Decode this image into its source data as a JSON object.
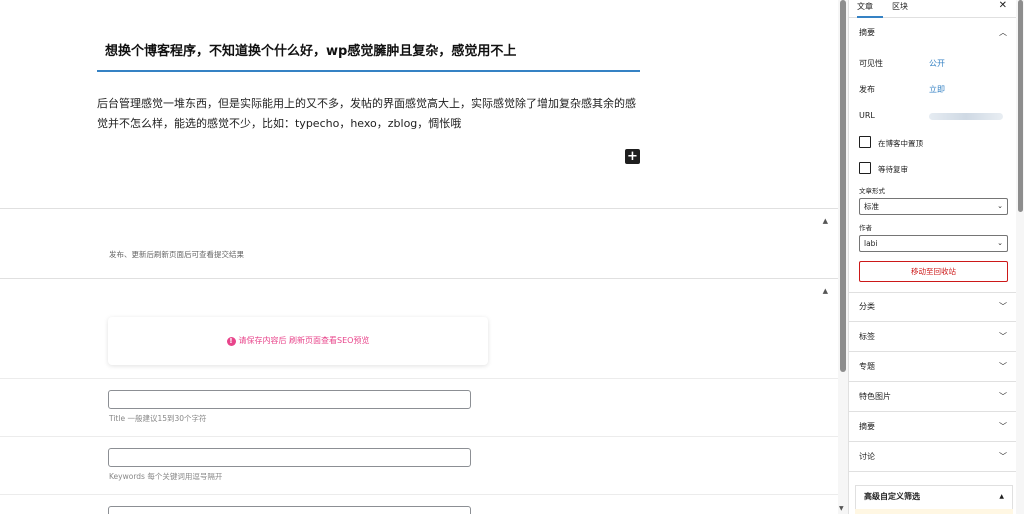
{
  "post": {
    "title": "想换个博客程序，不知道换个什么好，wp感觉臃肿且复杂，感觉用不上",
    "body": "后台管理感觉一堆东西，但是实际能用上的又不多，发帖的界面感觉高大上，实际感觉除了增加复杂感其余的感觉并不怎么样，能选的感觉不少，比如：typecho，hexo，zblog，惆怅哦",
    "add_block_symbol": "+"
  },
  "meta_boxes": {
    "publish_hint": "发布、更新后刷新页面后可查看提交结果",
    "collapse_symbol": "▲",
    "seo_notice": "请保存内容后 刷新页面查看SEO预览",
    "seo_title_hint": "Title 一般建议15到30个字符",
    "seo_keywords_hint": "Keywords 每个关键词用逗号隔开"
  },
  "sidebar": {
    "tabs": [
      "文章",
      "区块"
    ],
    "close_symbol": "✕",
    "summary_panel": {
      "title": "摘要",
      "visibility_label": "可见性",
      "visibility_value": "公开",
      "publish_label": "发布",
      "publish_value": "立即",
      "url_label": "URL",
      "sticky_label": "在博客中置顶",
      "pending_label": "等待复审",
      "format_label": "文章形式",
      "format_value": "标准",
      "author_label": "作者",
      "author_value": "labi",
      "trash_label": "移动至回收站"
    },
    "panels": [
      "分类",
      "标签",
      "专题",
      "特色图片",
      "摘要",
      "讨论"
    ],
    "advanced_title": "高级自定义筛选"
  },
  "colors": {
    "accent": "#3582c4",
    "danger": "#cc1818",
    "seo_pink": "#e8458b"
  }
}
